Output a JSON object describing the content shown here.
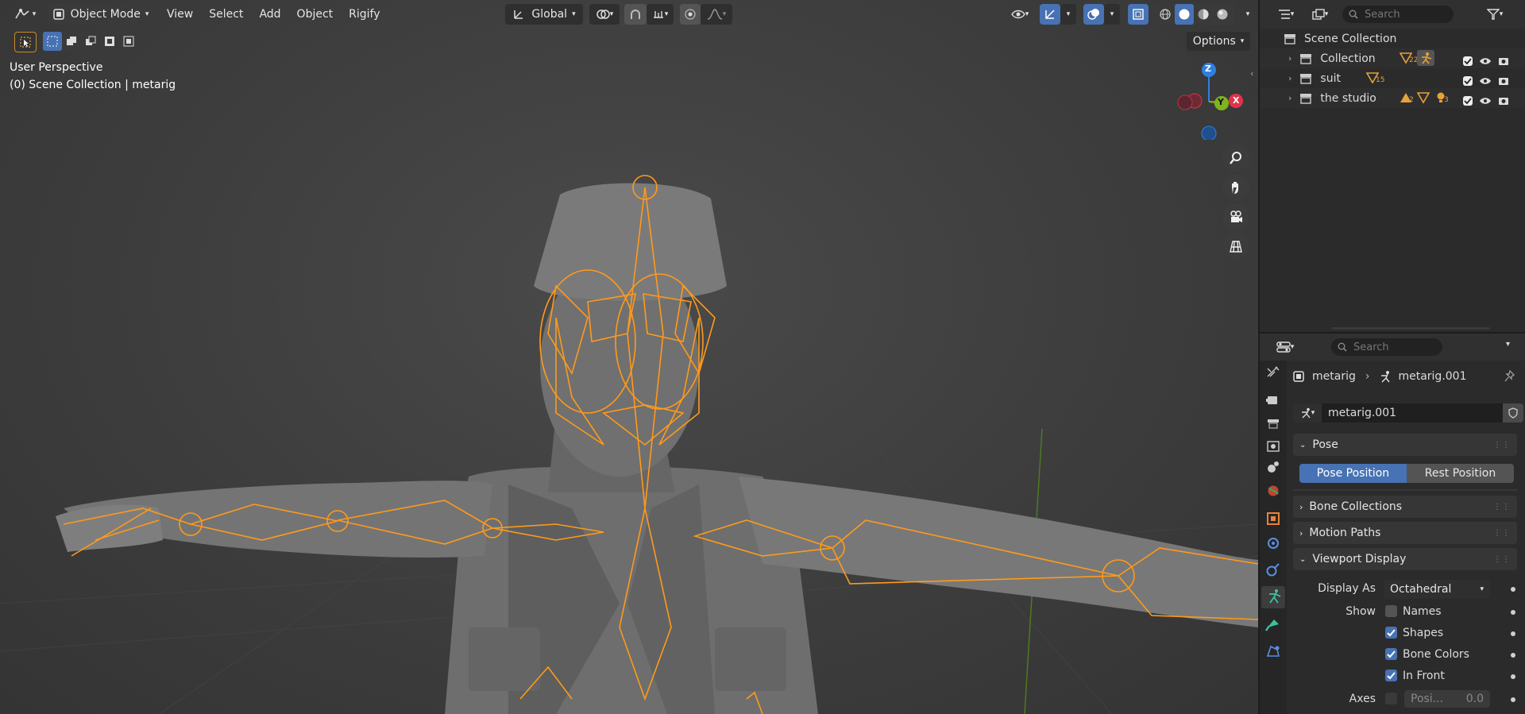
{
  "header": {
    "mode": "Object Mode",
    "menus": [
      "View",
      "Select",
      "Add",
      "Object",
      "Rigify"
    ],
    "transform_orientation": "Global",
    "options_label": "Options"
  },
  "viewport": {
    "view_name": "User Perspective",
    "context": "(0) Scene Collection | metarig",
    "gizmo_axes": [
      "Z",
      "Y",
      "X"
    ]
  },
  "outliner": {
    "search_placeholder": "Search",
    "root": "Scene Collection",
    "items": [
      {
        "name": "Collection",
        "badge": "22"
      },
      {
        "name": "suit",
        "badge": "15"
      },
      {
        "name": "the studio",
        "badge": "2",
        "badge2": "3"
      }
    ]
  },
  "properties": {
    "search_placeholder": "Search",
    "breadcrumb_object": "metarig",
    "breadcrumb_data": "metarig.001",
    "datablock_name": "metarig.001",
    "panels": {
      "pose": "Pose",
      "pose_position": "Pose Position",
      "rest_position": "Rest Position",
      "bone_collections": "Bone Collections",
      "motion_paths": "Motion Paths",
      "viewport_display": "Viewport Display",
      "display_as_label": "Display As",
      "display_as_value": "Octahedral",
      "show_label": "Show",
      "names": "Names",
      "shapes": "Shapes",
      "bone_colors": "Bone Colors",
      "in_front": "In Front",
      "axes_label": "Axes",
      "axes_position": "Posi...",
      "axes_value": "0.0"
    },
    "checks": {
      "names": false,
      "shapes": true,
      "bone_colors": true,
      "in_front": true,
      "axes": false
    }
  },
  "colors": {
    "accent": "#4772b3",
    "bone": "#ff9a1a",
    "axis_x": "#e0334b",
    "axis_y": "#7fb31f",
    "axis_z": "#2f7fe0"
  }
}
